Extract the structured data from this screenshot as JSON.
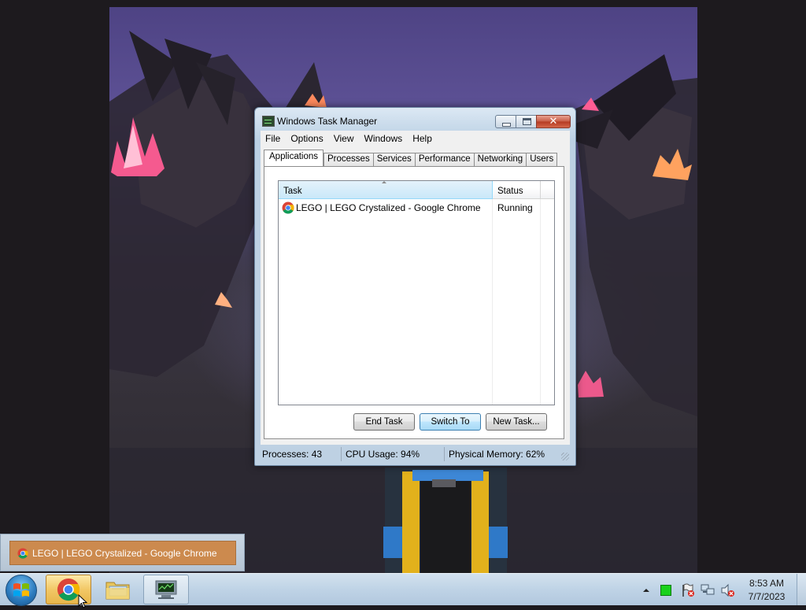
{
  "thumbnail": {
    "title": "LEGO | LEGO Crystalized - Google Chrome"
  },
  "window": {
    "title": "Windows Task Manager",
    "menu": [
      "File",
      "Options",
      "View",
      "Windows",
      "Help"
    ],
    "tabs": [
      "Applications",
      "Processes",
      "Services",
      "Performance",
      "Networking",
      "Users"
    ],
    "active_tab": "Applications",
    "columns": [
      "Task",
      "Status"
    ],
    "rows": [
      {
        "task": "LEGO | LEGO Crystalized - Google Chrome",
        "status": "Running"
      }
    ],
    "buttons": {
      "end_task": "End Task",
      "switch_to": "Switch To",
      "new_task": "New Task..."
    },
    "statusbar": {
      "processes": "Processes: 43",
      "cpu": "CPU Usage: 94%",
      "memory": "Physical Memory: 62%"
    }
  },
  "taskbar": {
    "pinned": [
      "start-orb",
      "chrome-icon",
      "explorer-icon",
      "task-manager-icon"
    ],
    "active": "chrome-icon",
    "tray_icons": [
      "show-hidden-icons-arrow",
      "green-square-icon",
      "action-center-flag-icon",
      "network-icon",
      "volume-muted-icon"
    ],
    "clock": {
      "time": "8:53 AM",
      "date": "7/7/2023"
    }
  },
  "colors": {
    "thumbnail_bar": "#cc8a4e",
    "crystal": "#ff4f8a",
    "taskbar": "#bfd3e6"
  }
}
